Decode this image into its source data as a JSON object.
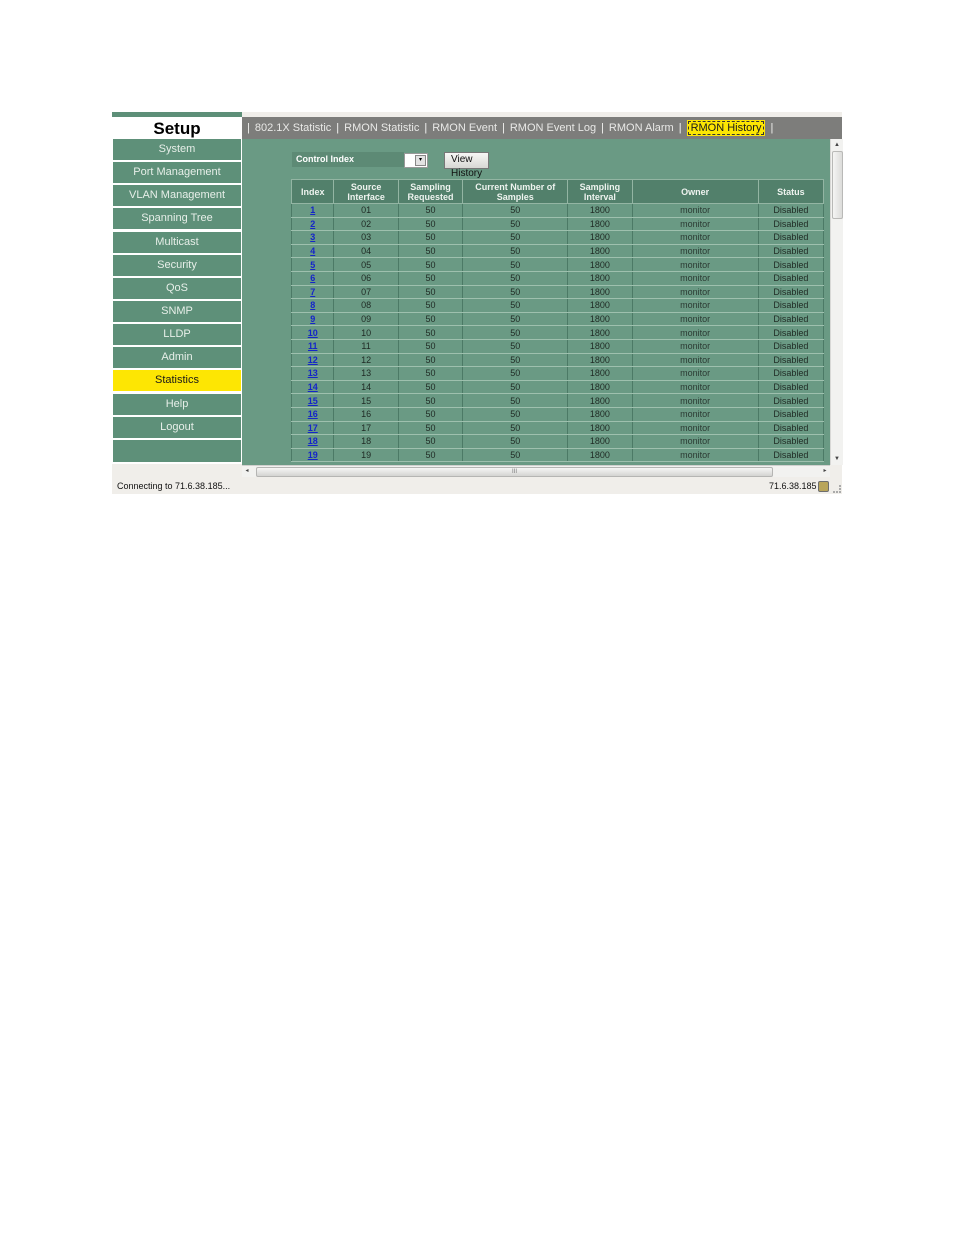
{
  "sidebar": {
    "title": "Setup",
    "items": [
      {
        "label": "System",
        "active": false
      },
      {
        "label": "Port Management",
        "active": false
      },
      {
        "label": "VLAN Management",
        "active": false
      },
      {
        "label": "Spanning Tree",
        "active": false
      },
      {
        "label": "Multicast",
        "active": false
      },
      {
        "label": "Security",
        "active": false
      },
      {
        "label": "QoS",
        "active": false
      },
      {
        "label": "SNMP",
        "active": false
      },
      {
        "label": "LLDP",
        "active": false
      },
      {
        "label": "Admin",
        "active": false
      },
      {
        "label": "Statistics",
        "active": true
      },
      {
        "label": "Help",
        "active": false
      },
      {
        "label": "Logout",
        "active": false
      }
    ]
  },
  "tabs": [
    {
      "label": "802.1X Statistic",
      "active": false
    },
    {
      "label": "RMON Statistic",
      "active": false
    },
    {
      "label": "RMON Event",
      "active": false
    },
    {
      "label": "RMON Event Log",
      "active": false
    },
    {
      "label": "RMON Alarm",
      "active": false
    },
    {
      "label": "RMON History",
      "active": true
    }
  ],
  "tab_separator": "|",
  "controls": {
    "control_index_label": "Control Index",
    "control_index_value": "",
    "select_arrow": "▾",
    "view_button": "View History Table"
  },
  "table": {
    "headers": [
      "Index",
      "Source Interface",
      "Sampling Requested",
      "Current Number of Samples",
      "Sampling Interval",
      "Owner",
      "Status"
    ],
    "rows": [
      [
        "1",
        "01",
        "50",
        "50",
        "1800",
        "monitor",
        "Disabled"
      ],
      [
        "2",
        "02",
        "50",
        "50",
        "1800",
        "monitor",
        "Disabled"
      ],
      [
        "3",
        "03",
        "50",
        "50",
        "1800",
        "monitor",
        "Disabled"
      ],
      [
        "4",
        "04",
        "50",
        "50",
        "1800",
        "monitor",
        "Disabled"
      ],
      [
        "5",
        "05",
        "50",
        "50",
        "1800",
        "monitor",
        "Disabled"
      ],
      [
        "6",
        "06",
        "50",
        "50",
        "1800",
        "monitor",
        "Disabled"
      ],
      [
        "7",
        "07",
        "50",
        "50",
        "1800",
        "monitor",
        "Disabled"
      ],
      [
        "8",
        "08",
        "50",
        "50",
        "1800",
        "monitor",
        "Disabled"
      ],
      [
        "9",
        "09",
        "50",
        "50",
        "1800",
        "monitor",
        "Disabled"
      ],
      [
        "10",
        "10",
        "50",
        "50",
        "1800",
        "monitor",
        "Disabled"
      ],
      [
        "11",
        "11",
        "50",
        "50",
        "1800",
        "monitor",
        "Disabled"
      ],
      [
        "12",
        "12",
        "50",
        "50",
        "1800",
        "monitor",
        "Disabled"
      ],
      [
        "13",
        "13",
        "50",
        "50",
        "1800",
        "monitor",
        "Disabled"
      ],
      [
        "14",
        "14",
        "50",
        "50",
        "1800",
        "monitor",
        "Disabled"
      ],
      [
        "15",
        "15",
        "50",
        "50",
        "1800",
        "monitor",
        "Disabled"
      ],
      [
        "16",
        "16",
        "50",
        "50",
        "1800",
        "monitor",
        "Disabled"
      ],
      [
        "17",
        "17",
        "50",
        "50",
        "1800",
        "monitor",
        "Disabled"
      ],
      [
        "18",
        "18",
        "50",
        "50",
        "1800",
        "monitor",
        "Disabled"
      ],
      [
        "19",
        "19",
        "50",
        "50",
        "1800",
        "monitor",
        "Disabled"
      ]
    ]
  },
  "scrollbars": {
    "up": "▲",
    "down": "▼",
    "left": "◂",
    "right": "▸",
    "grip": "≡",
    "hgrip": "III"
  },
  "statusbar": {
    "message": "Connecting to 71.6.38.185...",
    "address": "71.6.38.185"
  },
  "colors": {
    "panel_green": "#6a9a84",
    "nav_green": "#5e9079",
    "active_yellow": "#fde603",
    "tabbar_gray": "#7d7d7b",
    "link_blue": "#1525c9"
  }
}
